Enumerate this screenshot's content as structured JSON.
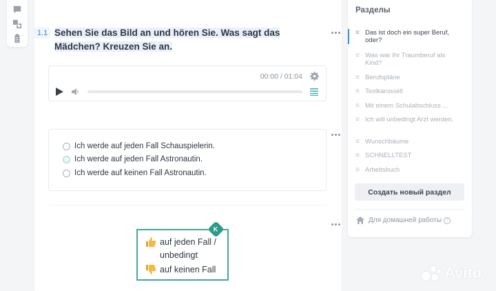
{
  "toolbar": {
    "tools": [
      {
        "icon": "comment-icon"
      },
      {
        "icon": "translate-icon"
      },
      {
        "icon": "clipboard-icon"
      }
    ]
  },
  "exercise": {
    "number": "1.1",
    "question": "Sehen Sie das Bild an und hören Sie. Was sagt das Mädchen? Kreuzen Sie an.",
    "audio": {
      "time": "00:00 / 01:04",
      "progress": 0
    },
    "options": [
      "Ich werde auf jeden Fall Schauspielerin.",
      "Ich werde auf jeden Fall Astronautin.",
      "Ich werde auf keinen Fall Astronautin."
    ]
  },
  "vocab_card": {
    "badge": "K",
    "line1": "auf jeden Fall /",
    "line2": "unbedingt",
    "line3": "auf keinen Fall"
  },
  "sections": {
    "title": "Разделы",
    "items": [
      {
        "label": "Das ist doch ein super Beruf, oder?",
        "active": true
      },
      {
        "label": "Was war Ihr Traumberuf als Kind?",
        "active": false
      },
      {
        "label": "Berufspläne",
        "active": false
      },
      {
        "label": "Textkarussell",
        "active": false
      },
      {
        "label": "Mit einem Schulabschluss ...",
        "active": false
      },
      {
        "label": "Ich will unbedingt Arzt werden.",
        "active": false
      },
      {
        "label": "Wunschbäume",
        "active": false
      },
      {
        "label": "SCHNELLTEST",
        "active": false
      },
      {
        "label": "Arbeitsbuch",
        "active": false
      }
    ],
    "create_button": "Создать новый раздел",
    "home_label": "Для домашней работы",
    "help_symbol": "?"
  },
  "watermark": {
    "text": "Avito"
  },
  "colors": {
    "accent": "#3a8fd0",
    "teal": "#3fa999"
  }
}
